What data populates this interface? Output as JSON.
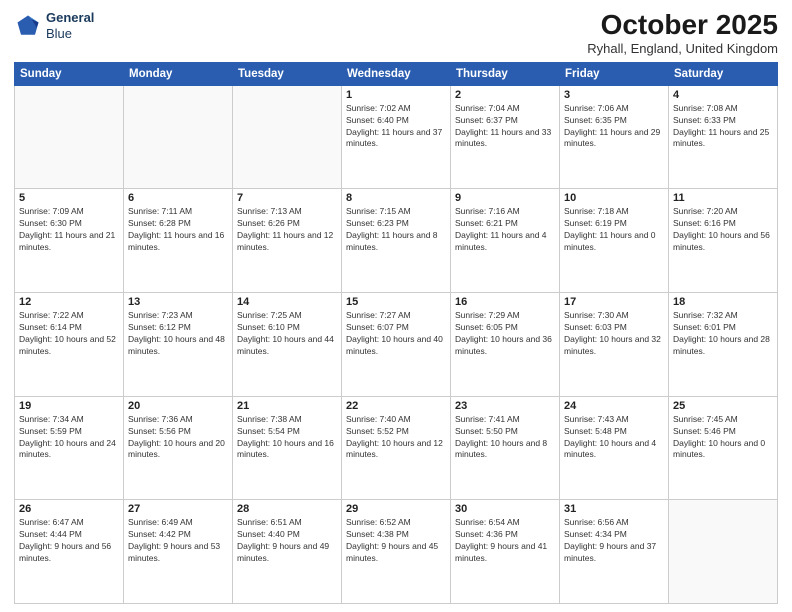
{
  "header": {
    "logo": {
      "line1": "General",
      "line2": "Blue"
    },
    "title": "October 2025",
    "location": "Ryhall, England, United Kingdom"
  },
  "days_of_week": [
    "Sunday",
    "Monday",
    "Tuesday",
    "Wednesday",
    "Thursday",
    "Friday",
    "Saturday"
  ],
  "weeks": [
    [
      {
        "day": "",
        "sunrise": "",
        "sunset": "",
        "daylight": ""
      },
      {
        "day": "",
        "sunrise": "",
        "sunset": "",
        "daylight": ""
      },
      {
        "day": "",
        "sunrise": "",
        "sunset": "",
        "daylight": ""
      },
      {
        "day": "1",
        "sunrise": "Sunrise: 7:02 AM",
        "sunset": "Sunset: 6:40 PM",
        "daylight": "Daylight: 11 hours and 37 minutes."
      },
      {
        "day": "2",
        "sunrise": "Sunrise: 7:04 AM",
        "sunset": "Sunset: 6:37 PM",
        "daylight": "Daylight: 11 hours and 33 minutes."
      },
      {
        "day": "3",
        "sunrise": "Sunrise: 7:06 AM",
        "sunset": "Sunset: 6:35 PM",
        "daylight": "Daylight: 11 hours and 29 minutes."
      },
      {
        "day": "4",
        "sunrise": "Sunrise: 7:08 AM",
        "sunset": "Sunset: 6:33 PM",
        "daylight": "Daylight: 11 hours and 25 minutes."
      }
    ],
    [
      {
        "day": "5",
        "sunrise": "Sunrise: 7:09 AM",
        "sunset": "Sunset: 6:30 PM",
        "daylight": "Daylight: 11 hours and 21 minutes."
      },
      {
        "day": "6",
        "sunrise": "Sunrise: 7:11 AM",
        "sunset": "Sunset: 6:28 PM",
        "daylight": "Daylight: 11 hours and 16 minutes."
      },
      {
        "day": "7",
        "sunrise": "Sunrise: 7:13 AM",
        "sunset": "Sunset: 6:26 PM",
        "daylight": "Daylight: 11 hours and 12 minutes."
      },
      {
        "day": "8",
        "sunrise": "Sunrise: 7:15 AM",
        "sunset": "Sunset: 6:23 PM",
        "daylight": "Daylight: 11 hours and 8 minutes."
      },
      {
        "day": "9",
        "sunrise": "Sunrise: 7:16 AM",
        "sunset": "Sunset: 6:21 PM",
        "daylight": "Daylight: 11 hours and 4 minutes."
      },
      {
        "day": "10",
        "sunrise": "Sunrise: 7:18 AM",
        "sunset": "Sunset: 6:19 PM",
        "daylight": "Daylight: 11 hours and 0 minutes."
      },
      {
        "day": "11",
        "sunrise": "Sunrise: 7:20 AM",
        "sunset": "Sunset: 6:16 PM",
        "daylight": "Daylight: 10 hours and 56 minutes."
      }
    ],
    [
      {
        "day": "12",
        "sunrise": "Sunrise: 7:22 AM",
        "sunset": "Sunset: 6:14 PM",
        "daylight": "Daylight: 10 hours and 52 minutes."
      },
      {
        "day": "13",
        "sunrise": "Sunrise: 7:23 AM",
        "sunset": "Sunset: 6:12 PM",
        "daylight": "Daylight: 10 hours and 48 minutes."
      },
      {
        "day": "14",
        "sunrise": "Sunrise: 7:25 AM",
        "sunset": "Sunset: 6:10 PM",
        "daylight": "Daylight: 10 hours and 44 minutes."
      },
      {
        "day": "15",
        "sunrise": "Sunrise: 7:27 AM",
        "sunset": "Sunset: 6:07 PM",
        "daylight": "Daylight: 10 hours and 40 minutes."
      },
      {
        "day": "16",
        "sunrise": "Sunrise: 7:29 AM",
        "sunset": "Sunset: 6:05 PM",
        "daylight": "Daylight: 10 hours and 36 minutes."
      },
      {
        "day": "17",
        "sunrise": "Sunrise: 7:30 AM",
        "sunset": "Sunset: 6:03 PM",
        "daylight": "Daylight: 10 hours and 32 minutes."
      },
      {
        "day": "18",
        "sunrise": "Sunrise: 7:32 AM",
        "sunset": "Sunset: 6:01 PM",
        "daylight": "Daylight: 10 hours and 28 minutes."
      }
    ],
    [
      {
        "day": "19",
        "sunrise": "Sunrise: 7:34 AM",
        "sunset": "Sunset: 5:59 PM",
        "daylight": "Daylight: 10 hours and 24 minutes."
      },
      {
        "day": "20",
        "sunrise": "Sunrise: 7:36 AM",
        "sunset": "Sunset: 5:56 PM",
        "daylight": "Daylight: 10 hours and 20 minutes."
      },
      {
        "day": "21",
        "sunrise": "Sunrise: 7:38 AM",
        "sunset": "Sunset: 5:54 PM",
        "daylight": "Daylight: 10 hours and 16 minutes."
      },
      {
        "day": "22",
        "sunrise": "Sunrise: 7:40 AM",
        "sunset": "Sunset: 5:52 PM",
        "daylight": "Daylight: 10 hours and 12 minutes."
      },
      {
        "day": "23",
        "sunrise": "Sunrise: 7:41 AM",
        "sunset": "Sunset: 5:50 PM",
        "daylight": "Daylight: 10 hours and 8 minutes."
      },
      {
        "day": "24",
        "sunrise": "Sunrise: 7:43 AM",
        "sunset": "Sunset: 5:48 PM",
        "daylight": "Daylight: 10 hours and 4 minutes."
      },
      {
        "day": "25",
        "sunrise": "Sunrise: 7:45 AM",
        "sunset": "Sunset: 5:46 PM",
        "daylight": "Daylight: 10 hours and 0 minutes."
      }
    ],
    [
      {
        "day": "26",
        "sunrise": "Sunrise: 6:47 AM",
        "sunset": "Sunset: 4:44 PM",
        "daylight": "Daylight: 9 hours and 56 minutes."
      },
      {
        "day": "27",
        "sunrise": "Sunrise: 6:49 AM",
        "sunset": "Sunset: 4:42 PM",
        "daylight": "Daylight: 9 hours and 53 minutes."
      },
      {
        "day": "28",
        "sunrise": "Sunrise: 6:51 AM",
        "sunset": "Sunset: 4:40 PM",
        "daylight": "Daylight: 9 hours and 49 minutes."
      },
      {
        "day": "29",
        "sunrise": "Sunrise: 6:52 AM",
        "sunset": "Sunset: 4:38 PM",
        "daylight": "Daylight: 9 hours and 45 minutes."
      },
      {
        "day": "30",
        "sunrise": "Sunrise: 6:54 AM",
        "sunset": "Sunset: 4:36 PM",
        "daylight": "Daylight: 9 hours and 41 minutes."
      },
      {
        "day": "31",
        "sunrise": "Sunrise: 6:56 AM",
        "sunset": "Sunset: 4:34 PM",
        "daylight": "Daylight: 9 hours and 37 minutes."
      },
      {
        "day": "",
        "sunrise": "",
        "sunset": "",
        "daylight": ""
      }
    ]
  ]
}
